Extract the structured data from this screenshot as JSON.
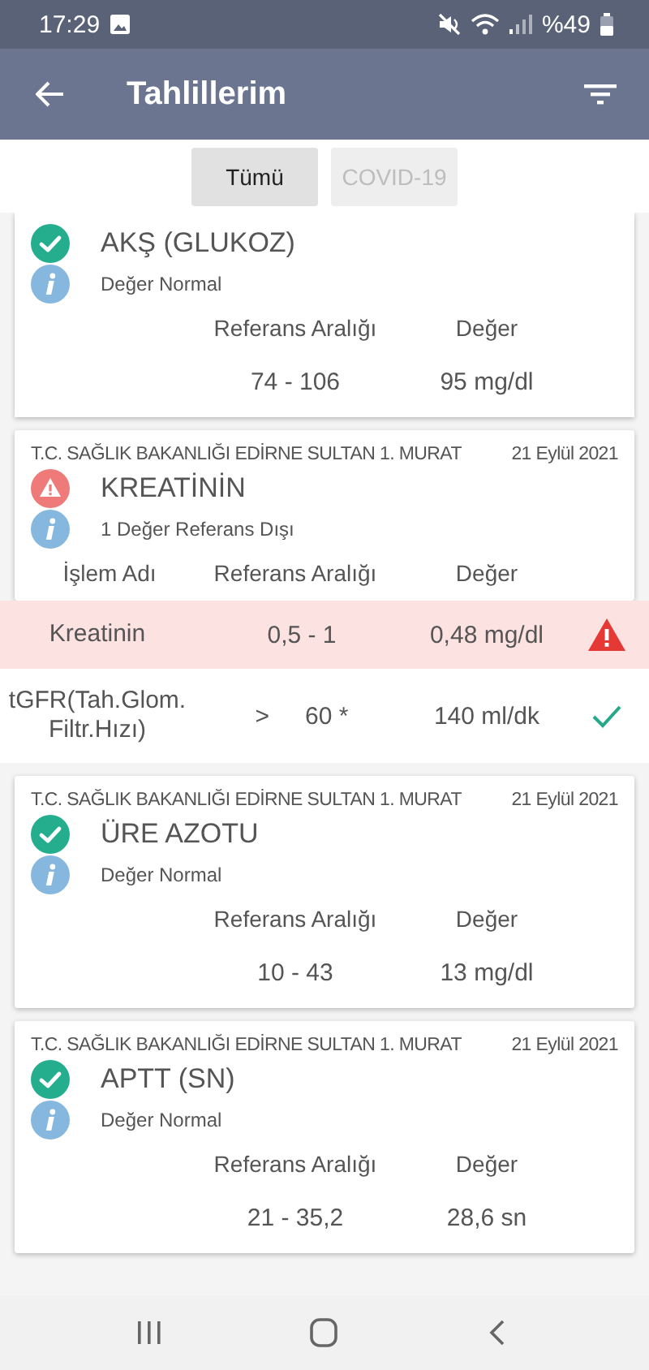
{
  "status_bar": {
    "time": "17:29",
    "battery": "%49"
  },
  "app_bar": {
    "title": "Tahlillerim"
  },
  "tabs": [
    {
      "label": "Tümü",
      "selected": true
    },
    {
      "label": "COVID-19",
      "selected": false
    }
  ],
  "results": [
    {
      "kind": "summary",
      "out_of_range": false,
      "title": "AKŞ (GLUKOZ)",
      "info": "Değer Normal",
      "columns": [
        "Referans Aralığı",
        "Değer"
      ],
      "range": "74 - 106",
      "value": "95 mg/dl"
    },
    {
      "kind": "detail",
      "institution": "T.C. SAĞLIK BAKANLIĞI EDİRNE SULTAN 1. MURAT",
      "date": "21 Eylül 2021",
      "out_of_range": true,
      "title": "KREATİNİN",
      "info": "1 Değer Referans Dışı",
      "columns": [
        "İşlem Adı",
        "Referans Aralığı",
        "Değer"
      ],
      "rows": [
        {
          "name": "Kreatinin",
          "range": "0,5 - 1",
          "value": "0,48 mg/dl",
          "out_of_range": true
        },
        {
          "name": "tGFR(Tah.Glom.Filtr.Hızı)",
          "range_prefix": ">",
          "range": "60 *",
          "value": "140 ml/dk",
          "out_of_range": false
        }
      ]
    },
    {
      "kind": "summary",
      "institution": "T.C. SAĞLIK BAKANLIĞI EDİRNE SULTAN 1. MURAT",
      "date": "21 Eylül 2021",
      "out_of_range": false,
      "title": "ÜRE AZOTU",
      "info": "Değer Normal",
      "columns": [
        "Referans Aralığı",
        "Değer"
      ],
      "range": "10 - 43",
      "value": "13 mg/dl"
    },
    {
      "kind": "summary",
      "institution": "T.C. SAĞLIK BAKANLIĞI EDİRNE SULTAN 1. MURAT",
      "date": "21 Eylül 2021",
      "out_of_range": false,
      "title": "APTT (SN)",
      "info": "Değer Normal",
      "columns": [
        "Referans Aralığı",
        "Değer"
      ],
      "range": "21 - 35,2",
      "value": "28,6 sn"
    }
  ]
}
